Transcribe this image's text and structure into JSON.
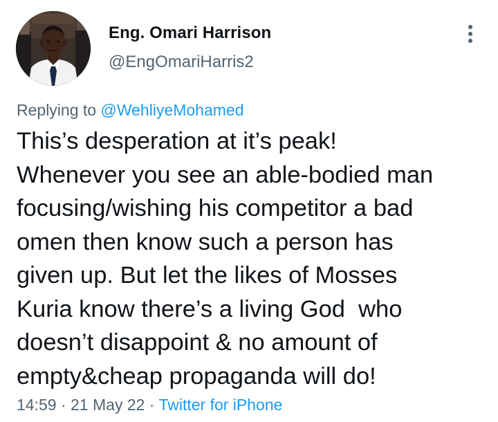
{
  "author": {
    "display_name": "Eng. Omari Harrison",
    "handle": "@EngOmariHarris2"
  },
  "reply": {
    "prefix": "Replying to ",
    "mention": "@WehliyeMohamed"
  },
  "body_lines": [
    "This’s desperation at it’s peak!",
    "Whenever you see an able-bodied man",
    "focusing/wishing his competitor a bad",
    "omen then know such a person has",
    "given up. But let the likes of Mosses",
    "Kuria know there’s a living God  who",
    "doesn’t disappoint & no amount of",
    "empty&cheap propaganda will do!"
  ],
  "meta": {
    "time": "14:59",
    "sep1": " · ",
    "date": "21 May 22",
    "sep2": " · ",
    "source": "Twitter for iPhone"
  },
  "icons": {
    "more": "more-vertical-icon"
  },
  "colors": {
    "text": "#0f1419",
    "secondary": "#536471",
    "link": "#1d9bf0"
  }
}
